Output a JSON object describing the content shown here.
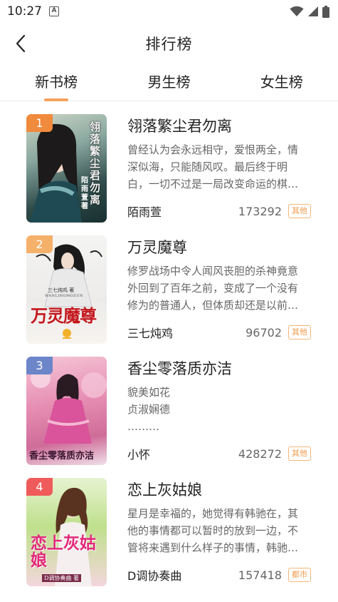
{
  "status": {
    "time": "10:27",
    "sim_label": "A"
  },
  "nav": {
    "title": "排行榜"
  },
  "tabs": [
    {
      "label": "新书榜",
      "active": true
    },
    {
      "label": "男生榜",
      "active": false
    },
    {
      "label": "女生榜",
      "active": false
    }
  ],
  "books": [
    {
      "rank": "1",
      "rank_color": "#f08a3c",
      "title": "翎落繁尘君勿离",
      "desc_lines": [
        "曾经认为会永远相守，爱恨两全，情",
        "深似海，只能随风叹。最后终于明",
        "白，一切不过是一局改变命运的棋…"
      ],
      "author": "陌雨萱",
      "count": "173292",
      "tag": "其他",
      "cover_text": [
        "翎落繁尘君勿离",
        "陌雨萱 著"
      ]
    },
    {
      "rank": "2",
      "rank_color": "#f5b06a",
      "title": "万灵魔尊",
      "desc_lines": [
        "修罗战场中令人闻风丧胆的杀神竟意",
        "外回到了百年之前，变成了一个没有",
        "修为的普通人，但体质却还是以前…"
      ],
      "author": "三七炖鸡",
      "count": "96702",
      "tag": "其他",
      "cover_text": [
        "三七炖鸡 著",
        "WANLINGMOZUN",
        "万灵魔尊"
      ]
    },
    {
      "rank": "3",
      "rank_color": "#6c86c9",
      "title": "香尘零落质亦洁",
      "desc_lines": [
        "貌美如花",
        "贞淑娴德",
        "………"
      ],
      "author": "小怀",
      "count": "428272",
      "tag": "其他",
      "cover_text": [
        "香尘零落质亦洁"
      ]
    },
    {
      "rank": "4",
      "rank_color": "#ef5b5b",
      "title": "恋上灰姑娘",
      "desc_lines": [
        "星月是幸福的，她觉得有韩驰在，其",
        "他的事情都可以暂时的放到一边，不",
        "管将来遇到什么样子的事情，韩驰…"
      ],
      "author": "D调协奏曲",
      "count": "157418",
      "tag": "都市",
      "cover_text": [
        "恋上灰姑娘",
        "D调协奏曲 著"
      ]
    }
  ]
}
